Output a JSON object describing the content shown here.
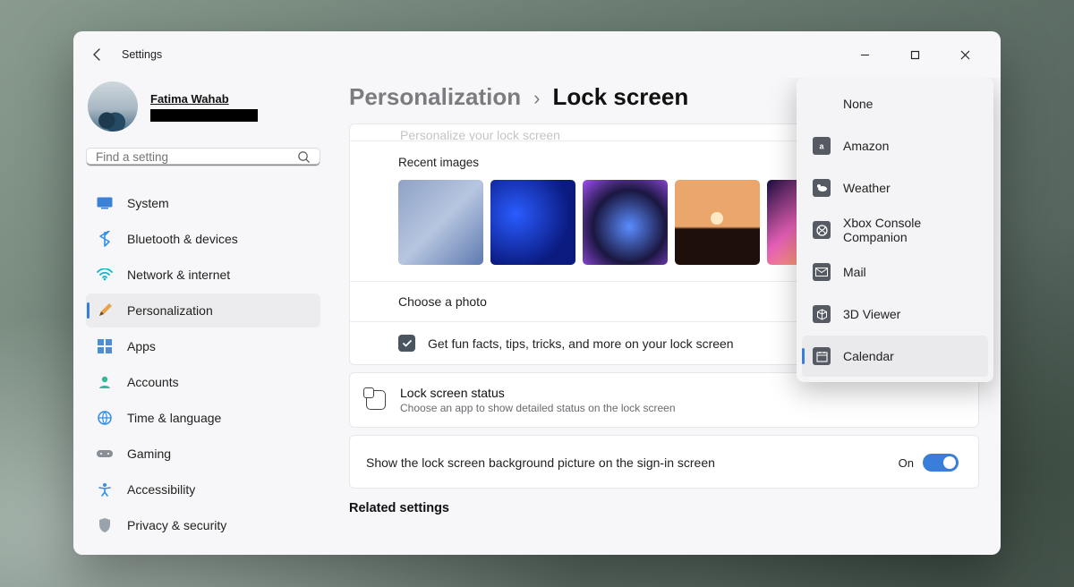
{
  "window": {
    "title": "Settings",
    "search_placeholder": "Find a setting"
  },
  "profile": {
    "name": "Fatima Wahab"
  },
  "sidebar": {
    "items": [
      {
        "label": "System"
      },
      {
        "label": "Bluetooth & devices"
      },
      {
        "label": "Network & internet"
      },
      {
        "label": "Personalization"
      },
      {
        "label": "Apps"
      },
      {
        "label": "Accounts"
      },
      {
        "label": "Time & language"
      },
      {
        "label": "Gaming"
      },
      {
        "label": "Accessibility"
      },
      {
        "label": "Privacy & security"
      }
    ]
  },
  "breadcrumb": {
    "parent": "Personalization",
    "current": "Lock screen"
  },
  "personalize": {
    "truncated_heading": "Personalize your lock screen",
    "recent_label": "Recent images",
    "choose_photo": "Choose a photo",
    "fun_facts": "Get fun facts, tips, tricks, and more on your lock screen"
  },
  "status": {
    "heading": "Lock screen status",
    "sub": "Choose an app to show detailed status on the lock screen"
  },
  "toggle": {
    "label": "Show the lock screen background picture on the sign-in screen",
    "state": "On"
  },
  "related_heading": "Related settings",
  "menu": {
    "items": [
      {
        "label": "None"
      },
      {
        "label": "Amazon"
      },
      {
        "label": "Weather"
      },
      {
        "label": "Xbox Console Companion"
      },
      {
        "label": "Mail"
      },
      {
        "label": "3D Viewer"
      },
      {
        "label": "Calendar"
      }
    ]
  }
}
